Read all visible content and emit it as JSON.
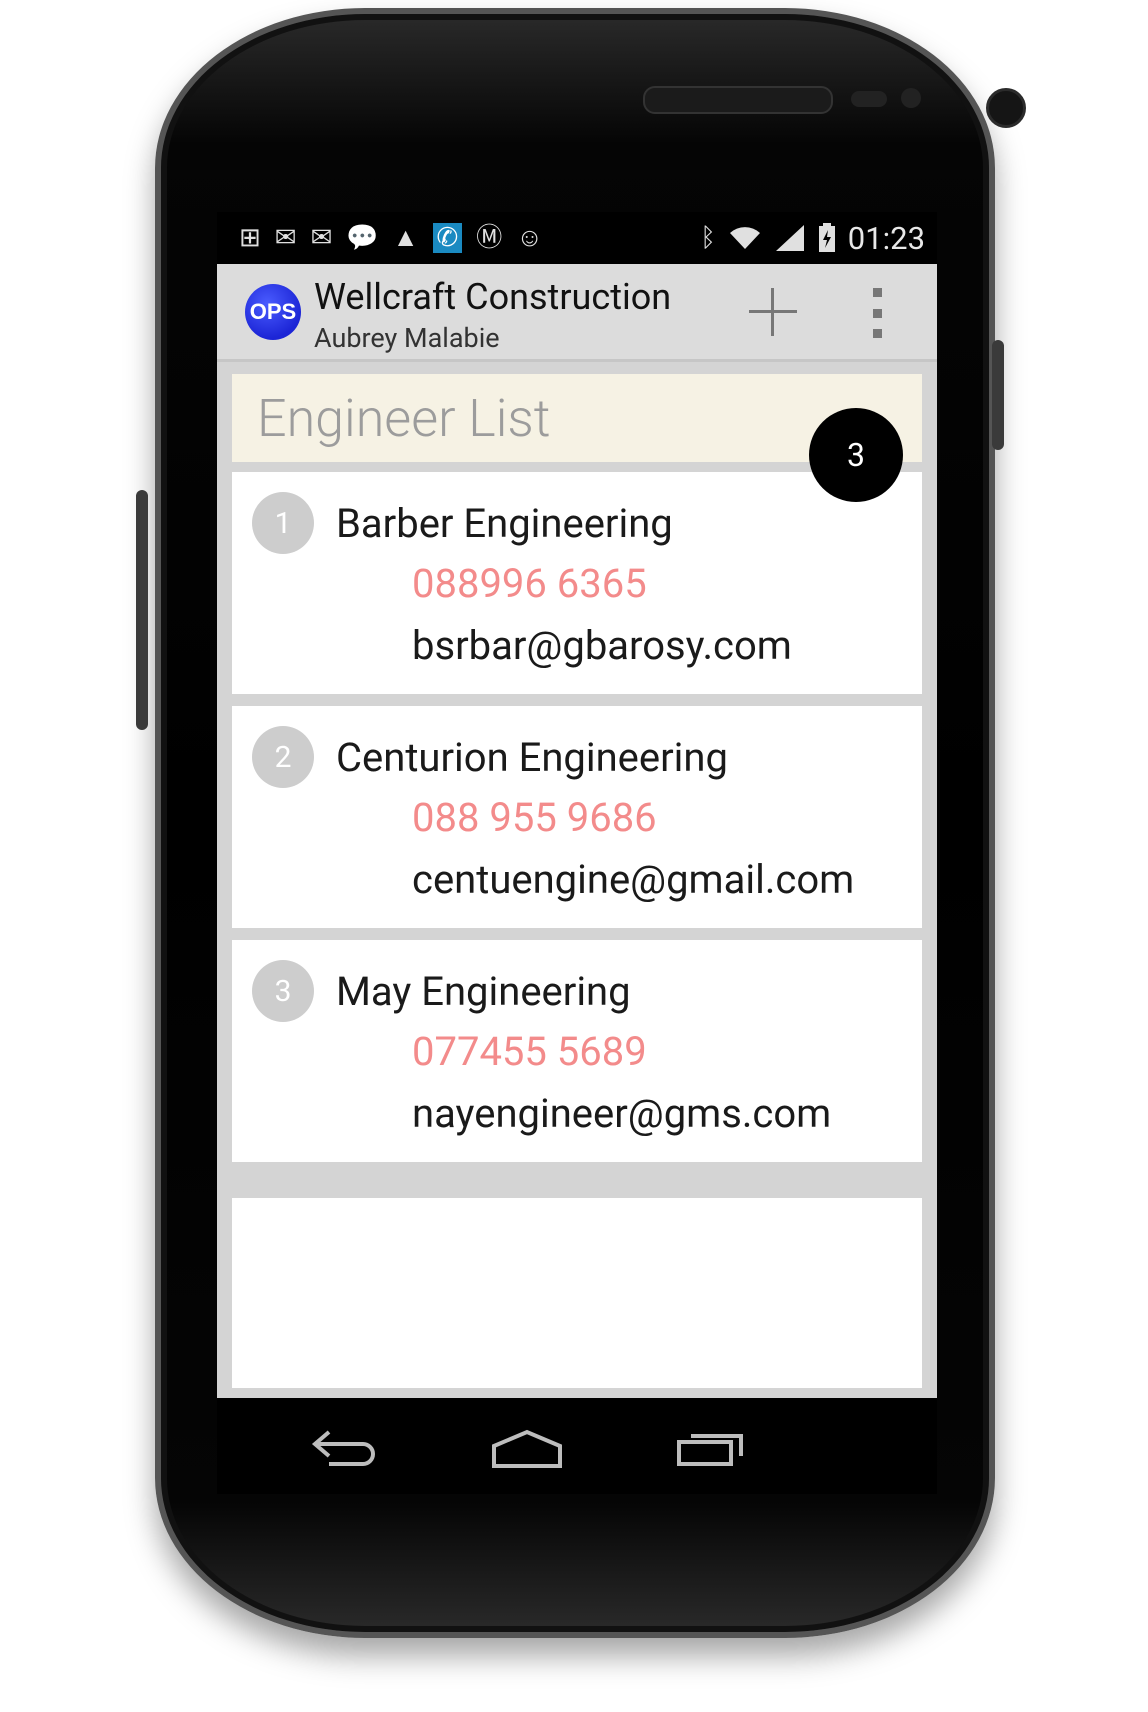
{
  "statusbar": {
    "left_icons": [
      "add-box-icon",
      "gmail-icon",
      "gmail-icon",
      "chat-icon",
      "warning-icon",
      "missed-call-icon",
      "motorola-icon",
      "messaging-icon"
    ],
    "right_icons": [
      "bluetooth-icon",
      "wifi-icon",
      "signal-icon",
      "battery-charging-icon"
    ],
    "time": "01:23"
  },
  "actionbar": {
    "logo_text": "OPS",
    "title": "Wellcraft Construction",
    "subtitle": "Aubrey Malabie"
  },
  "header": {
    "title": "Engineer List",
    "count": "3"
  },
  "engineers": [
    {
      "number": "1",
      "name": "Barber Engineering",
      "phone": "088996 6365",
      "email": "bsrbar@gbarosy.com"
    },
    {
      "number": "2",
      "name": "Centurion Engineering",
      "phone": "088 955 9686",
      "email": "centuengine@gmail.com"
    },
    {
      "number": "3",
      "name": "May Engineering",
      "phone": "077455 5689",
      "email": "nayengineer@gms.com"
    }
  ],
  "colors": {
    "phone_text": "#f38b8b",
    "header_bg": "#f6f2e4",
    "logo_blue": "#1c25d6"
  }
}
